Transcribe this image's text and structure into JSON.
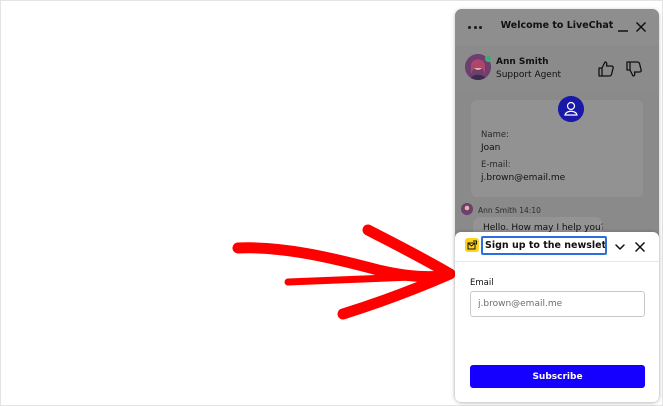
{
  "colors": {
    "accent": "#1500ff",
    "arrow": "#ff0000",
    "overlay": "#8a8a8a",
    "newsletter_icon": "#ffd21f",
    "card_avatar": "#1a18a8"
  },
  "window": {
    "title": "Welcome to LiveChat",
    "menu_icon": "more-horizontal-icon",
    "minimize_icon": "minimize-icon",
    "close_icon": "close-icon"
  },
  "agent": {
    "name": "Ann Smith",
    "role": "Support Agent",
    "status": "online",
    "rate_up_icon": "thumbs-up-icon",
    "rate_down_icon": "thumbs-down-icon"
  },
  "info_card": {
    "name_label": "Name:",
    "name_value": "Joan",
    "email_label": "E-mail:",
    "email_value": "j.brown@email.me"
  },
  "message": {
    "author": "Ann Smith",
    "time": "14:10",
    "text": "Hello. How may I help you?"
  },
  "newsletter": {
    "title": "Sign up to the newsletter",
    "email_label": "Email",
    "email_placeholder": "j.brown@email.me",
    "subscribe_label": "Subscribe"
  }
}
